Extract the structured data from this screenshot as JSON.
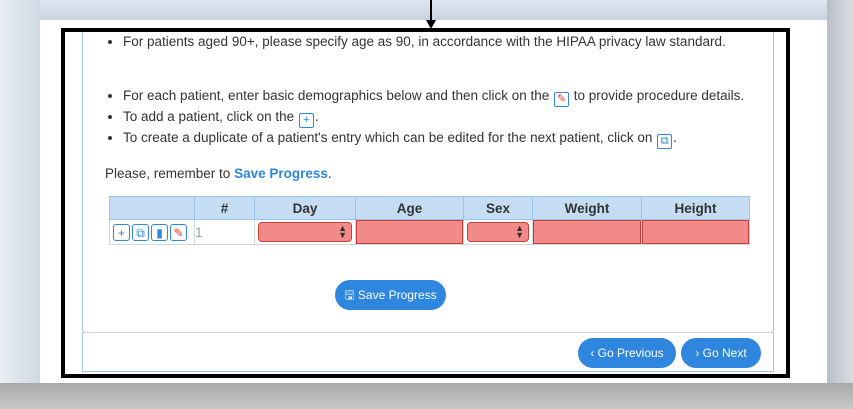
{
  "bullets_top": [
    "For patients aged 90+, please specify age as 90, in accordance with the HIPAA privacy law standard."
  ],
  "bullets_main": [
    {
      "before": "For each patient, enter basic demographics below and then click on the ",
      "icon": "pencil-icon",
      "after": " to provide procedure details."
    },
    {
      "before": "To add a patient, click on the ",
      "icon": "plus-icon",
      "after": "."
    },
    {
      "before": "To create a duplicate of a patient's entry which can be edited for the next patient, click on ",
      "icon": "duplicate-icon",
      "after": "."
    }
  ],
  "reminder": {
    "prefix": "Please, remember to ",
    "link": "Save Progress",
    "suffix": "."
  },
  "table": {
    "headers": [
      "",
      "#",
      "Day",
      "Age",
      "Sex",
      "Weight",
      "Height"
    ],
    "row": {
      "number": "1",
      "day": "",
      "age": "",
      "sex": "",
      "weight": "",
      "height": ""
    }
  },
  "buttons": {
    "save": "Save Progress",
    "previous": "Go Previous",
    "next": "Go Next"
  },
  "colors": {
    "accent": "#2e86de",
    "invalid_fill": "#f28b87",
    "header_fill": "#c5ddf3"
  }
}
